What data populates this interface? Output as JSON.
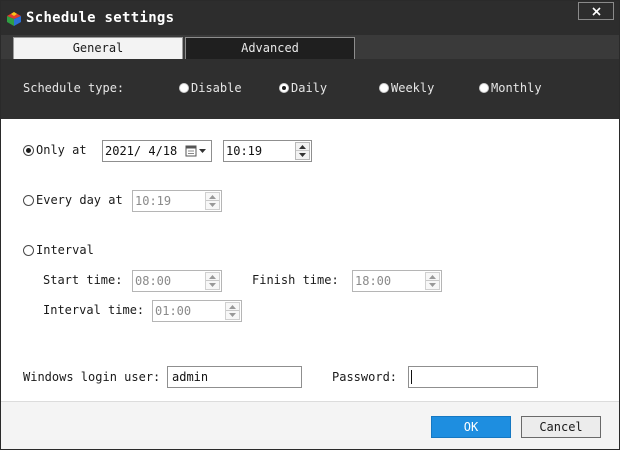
{
  "window": {
    "title": "Schedule settings",
    "close_label": "x"
  },
  "tabs": [
    {
      "label": "General",
      "active": true
    },
    {
      "label": "Advanced",
      "active": false
    }
  ],
  "schedule_type": {
    "label": "Schedule type:",
    "options": [
      {
        "label": "Disable",
        "checked": false
      },
      {
        "label": "Daily",
        "checked": true
      },
      {
        "label": "Weekly",
        "checked": false
      },
      {
        "label": "Monthly",
        "checked": false
      }
    ]
  },
  "only_at": {
    "label": "Only at",
    "checked": true,
    "date": "2021/ 4/18",
    "time": "10:19"
  },
  "every_day_at": {
    "label": "Every day at",
    "checked": false,
    "time": "10:19"
  },
  "interval": {
    "label": "Interval",
    "checked": false,
    "start_label": "Start time:",
    "start_time": "08:00",
    "finish_label": "Finish time:",
    "finish_time": "18:00",
    "interval_label": "Interval time:",
    "interval_time": "01:00"
  },
  "login": {
    "user_label": "Windows login user:",
    "user_value": "admin",
    "password_label": "Password:",
    "password_value": ""
  },
  "buttons": {
    "ok": "OK",
    "cancel": "Cancel"
  },
  "colors": {
    "titlebar": "#2d2d2d",
    "accent": "#1e8ee0"
  },
  "icons": {
    "logo": "app-logo-icon",
    "close": "close-icon",
    "calendar": "calendar-icon",
    "dropdown": "chevron-down-icon",
    "spin_up": "spin-up-icon",
    "spin_down": "spin-down-icon"
  }
}
